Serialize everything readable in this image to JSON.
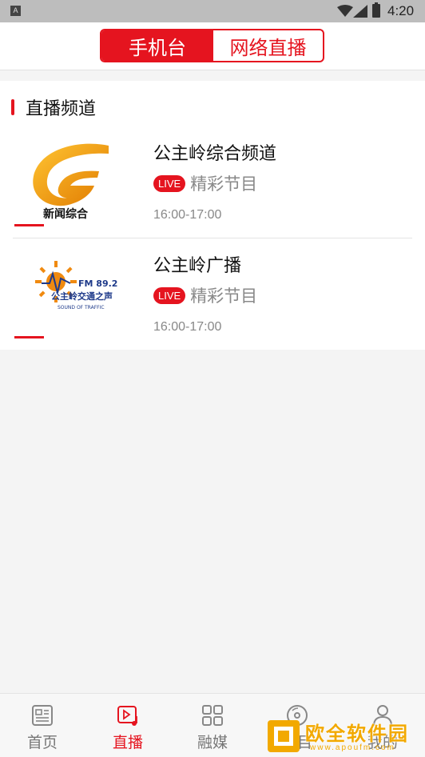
{
  "status_bar": {
    "time": "4:20",
    "left_badge": "A"
  },
  "top_tabs": {
    "active": "手机台",
    "inactive": "网络直播"
  },
  "section": {
    "title": "直播频道"
  },
  "channels": [
    {
      "name": "公主岭综合频道",
      "live_badge": "LIVE",
      "program": "精彩节目",
      "time": "16:00-17:00",
      "logo_text": "新闻综合",
      "logo_icon": "golden-g-logo"
    },
    {
      "name": "公主岭广播",
      "live_badge": "LIVE",
      "program": "精彩节目",
      "time": "16:00-17:00",
      "logo_text_fm": "FM 89.2",
      "logo_text_cn": "公主岭交通之声",
      "logo_text_en": "SOUND OF TRAFFIC",
      "logo_icon": "sun-wave-logo"
    }
  ],
  "bottom_nav": [
    {
      "label": "首页",
      "icon": "news-icon",
      "active": false
    },
    {
      "label": "直播",
      "icon": "live-play-icon",
      "active": true
    },
    {
      "label": "融媒",
      "icon": "grid-icon",
      "active": false
    },
    {
      "label": "栏目",
      "icon": "disc-icon",
      "active": false
    },
    {
      "label": "我的",
      "icon": "person-icon",
      "active": false
    }
  ],
  "watermark": {
    "text": "欧全软件园",
    "url": "www.apoufm.com"
  },
  "colors": {
    "accent": "#e5141f",
    "watermark": "#f2a900"
  }
}
